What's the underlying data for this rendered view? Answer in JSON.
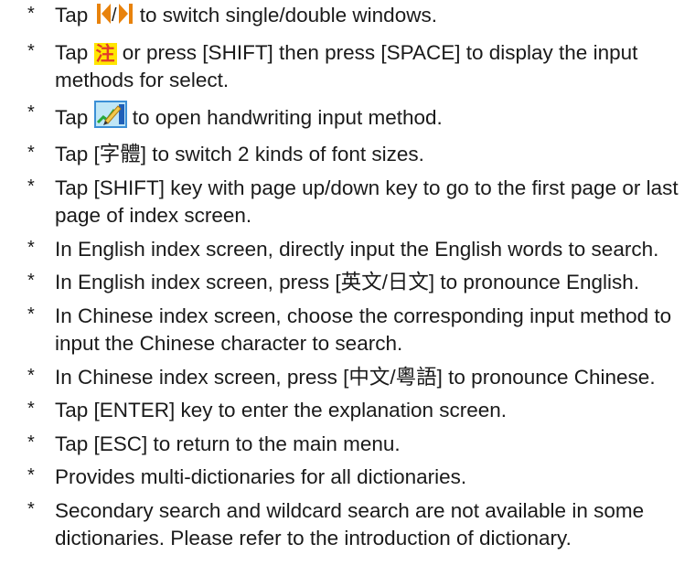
{
  "instructions": [
    {
      "bullet": "*",
      "before": "Tap ",
      "icon": "arrow-switch-icon",
      "after": " to switch single/double windows."
    },
    {
      "bullet": "*",
      "before": "Tap ",
      "icon": "input-method-icon",
      "icon_text": "注",
      "after": " or press [SHIFT] then press [SPACE] to display the input methods for select."
    },
    {
      "bullet": "*",
      "before": "Tap ",
      "icon": "handwriting-icon",
      "after": " to open handwriting input method."
    },
    {
      "bullet": "*",
      "text": "Tap [字體] to switch 2 kinds of font sizes."
    },
    {
      "bullet": "*",
      "text": "Tap [SHIFT] key with page up/down key to go to the first page or last page of index screen."
    },
    {
      "bullet": "*",
      "text": "In English index screen, directly input the English words  to search."
    },
    {
      "bullet": "*",
      "text": "In English index screen, press [英文/日文] to pronounce English."
    },
    {
      "bullet": "*",
      "text": "In Chinese index screen, choose the corresponding input method to input the Chinese  character  to search."
    },
    {
      "bullet": "*",
      "text": "In Chinese index screen, press [中文/粵語] to pronounce Chinese."
    },
    {
      "bullet": "*",
      "text": "Tap [ENTER] key to enter the explanation screen."
    },
    {
      "bullet": "*",
      "text": "Tap [ESC] to return to the main menu."
    },
    {
      "bullet": "*",
      "text": "Provides multi-dictionaries for all dictionaries."
    },
    {
      "bullet": "*",
      "text": "Secondary search and wildcard search are not available in some dictionaries. Please refer to the introduction of dictionary."
    }
  ],
  "colors": {
    "text": "#1a1a1a",
    "arrow_icon": "#e8820c",
    "input_icon_bg": "#ffe600",
    "input_icon_fg": "#e23b2b",
    "handwriting_bg": "#3b8fd6"
  }
}
